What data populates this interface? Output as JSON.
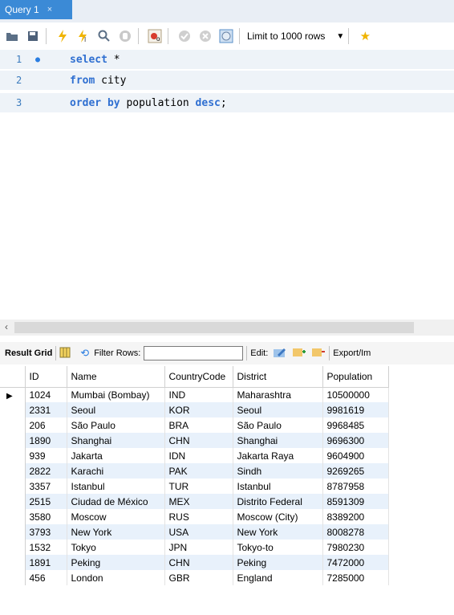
{
  "tab": {
    "title": "Query 1",
    "close": "×"
  },
  "toolbar": {
    "limit_label": "Limit to 1000 rows",
    "icons": [
      "folder-icon",
      "save-icon",
      "execute-icon",
      "execute-current-icon",
      "explain-icon",
      "stop-icon",
      "toggle-continue-icon",
      "commit-icon",
      "rollback-icon",
      "autocommit-icon",
      "dropdown-icon",
      "bookmark-icon"
    ]
  },
  "editor": {
    "lines": [
      {
        "number": "1",
        "tokens": [
          {
            "t": "select",
            "kw": true
          },
          {
            "t": " *",
            "kw": false
          }
        ]
      },
      {
        "number": "2",
        "tokens": [
          {
            "t": "from",
            "kw": true
          },
          {
            "t": " city",
            "kw": false
          }
        ]
      },
      {
        "number": "3",
        "tokens": [
          {
            "t": "order by",
            "kw": true
          },
          {
            "t": " population ",
            "kw": false
          },
          {
            "t": "desc",
            "kw": true
          },
          {
            "t": ";",
            "kw": false
          }
        ]
      }
    ]
  },
  "result_toolbar": {
    "result_grid": "Result Grid",
    "filter_rows": "Filter Rows:",
    "edit": "Edit:",
    "export": "Export/Im"
  },
  "grid": {
    "columns": [
      "ID",
      "Name",
      "CountryCode",
      "District",
      "Population"
    ],
    "rows": [
      [
        "1024",
        "Mumbai (Bombay)",
        "IND",
        "Maharashtra",
        "10500000"
      ],
      [
        "2331",
        "Seoul",
        "KOR",
        "Seoul",
        "9981619"
      ],
      [
        "206",
        "São Paulo",
        "BRA",
        "São Paulo",
        "9968485"
      ],
      [
        "1890",
        "Shanghai",
        "CHN",
        "Shanghai",
        "9696300"
      ],
      [
        "939",
        "Jakarta",
        "IDN",
        "Jakarta Raya",
        "9604900"
      ],
      [
        "2822",
        "Karachi",
        "PAK",
        "Sindh",
        "9269265"
      ],
      [
        "3357",
        "Istanbul",
        "TUR",
        "Istanbul",
        "8787958"
      ],
      [
        "2515",
        "Ciudad de México",
        "MEX",
        "Distrito Federal",
        "8591309"
      ],
      [
        "3580",
        "Moscow",
        "RUS",
        "Moscow (City)",
        "8389200"
      ],
      [
        "3793",
        "New York",
        "USA",
        "New York",
        "8008278"
      ],
      [
        "1532",
        "Tokyo",
        "JPN",
        "Tokyo-to",
        "7980230"
      ],
      [
        "1891",
        "Peking",
        "CHN",
        "Peking",
        "7472000"
      ],
      [
        "456",
        "London",
        "GBR",
        "England",
        "7285000"
      ]
    ]
  }
}
